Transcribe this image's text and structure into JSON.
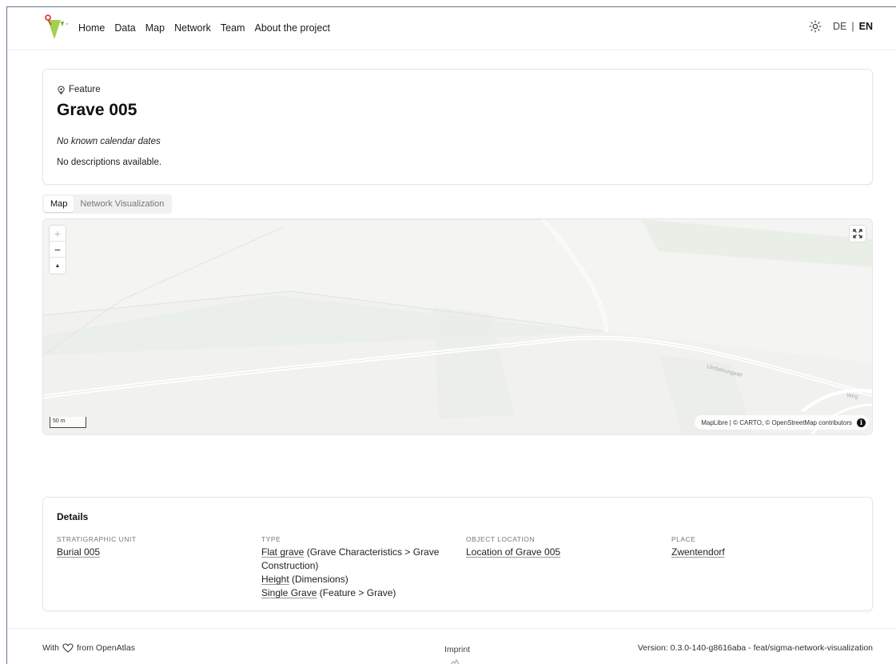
{
  "header": {
    "nav": [
      "Home",
      "Data",
      "Map",
      "Network",
      "Team",
      "About the project"
    ],
    "lang_de": "DE",
    "lang_sep": "|",
    "lang_en": "EN"
  },
  "feature": {
    "kicker": "Feature",
    "title": "Grave 005",
    "dates": "No known calendar dates",
    "description": "No descriptions available."
  },
  "tabs": [
    {
      "label": "Map",
      "active": true
    },
    {
      "label": "Network Visualization",
      "active": false
    }
  ],
  "map": {
    "zoom_in": "+",
    "zoom_out": "−",
    "compass": "▲",
    "scale": "50 m",
    "attribution": "MapLibre | © CARTO, © OpenStreetMap contributors",
    "road_label_1": "Umfahrungsstr",
    "road_label_2": "Weg"
  },
  "details": {
    "title": "Details",
    "columns": [
      {
        "label": "STRATIGRAPHIC UNIT",
        "items": [
          {
            "link": "Burial 005",
            "rest": ""
          }
        ]
      },
      {
        "label": "TYPE",
        "items": [
          {
            "link": "Flat grave",
            "rest": " (Grave Characteristics > Grave Construction)"
          },
          {
            "link": "Height",
            "rest": " (Dimensions)"
          },
          {
            "link": "Single Grave",
            "rest": " (Feature > Grave)"
          }
        ]
      },
      {
        "label": "OBJECT LOCATION",
        "items": [
          {
            "link": "Location of Grave 005",
            "rest": ""
          }
        ]
      },
      {
        "label": "PLACE",
        "items": [
          {
            "link": "Zwentendorf",
            "rest": ""
          }
        ]
      }
    ]
  },
  "footer": {
    "with": "With",
    "from": "from OpenAtlas",
    "imprint": "Imprint",
    "version": "Version: 0.3.0-140-g8616aba - feat/sigma-network-visualization"
  },
  "colors": {
    "logo_green": "#8bc34a",
    "logo_red": "#d32f2f",
    "map_bg": "#f4f5f3"
  }
}
